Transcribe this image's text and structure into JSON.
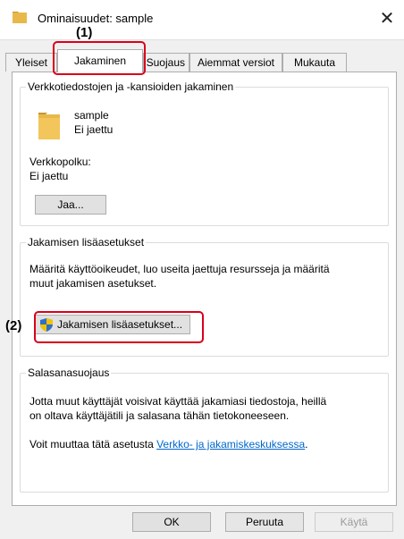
{
  "window": {
    "title": "Ominaisuudet: sample",
    "close_glyph": "✕",
    "folder_icon_color": "#e8b84a"
  },
  "tabs": [
    {
      "label": "Yleiset"
    },
    {
      "label": "Jakaminen"
    },
    {
      "label": "Suojaus"
    },
    {
      "label": "Aiemmat versiot"
    },
    {
      "label": "Mukauta"
    }
  ],
  "network_sharing": {
    "group_title": "Verkkotiedostojen ja -kansioiden jakaminen",
    "folder_name": "sample",
    "folder_status": "Ei jaettu",
    "path_label": "Verkkopolku:",
    "path_value": "Ei jaettu",
    "share_button_label": "Jaa..."
  },
  "advanced_sharing": {
    "group_title": "Jakamisen lisäasetukset",
    "description_line1": "Määritä käyttöoikeudet, luo useita jaettuja resursseja ja määritä",
    "description_line2": "muut jakamisen asetukset.",
    "button_label": "Jakamisen lisäasetukset..."
  },
  "password_protection": {
    "group_title": "Salasanasuojaus",
    "description_line1": "Jotta muut käyttäjät voisivat käyttää jakamiasi tiedostoja, heillä",
    "description_line2": "on oltava käyttäjätili ja salasana tähän tietokoneeseen.",
    "change_text": "Voit muuttaa tätä asetusta ",
    "link_text": "Verkko- ja jakamiskeskuksessa",
    "link_suffix": "."
  },
  "footer": {
    "ok_label": "OK",
    "cancel_label": "Peruuta",
    "apply_label": "Käytä"
  },
  "annotations": {
    "callout1": "(1)",
    "callout2": "(2)",
    "highlight_color": "#d9001b"
  }
}
